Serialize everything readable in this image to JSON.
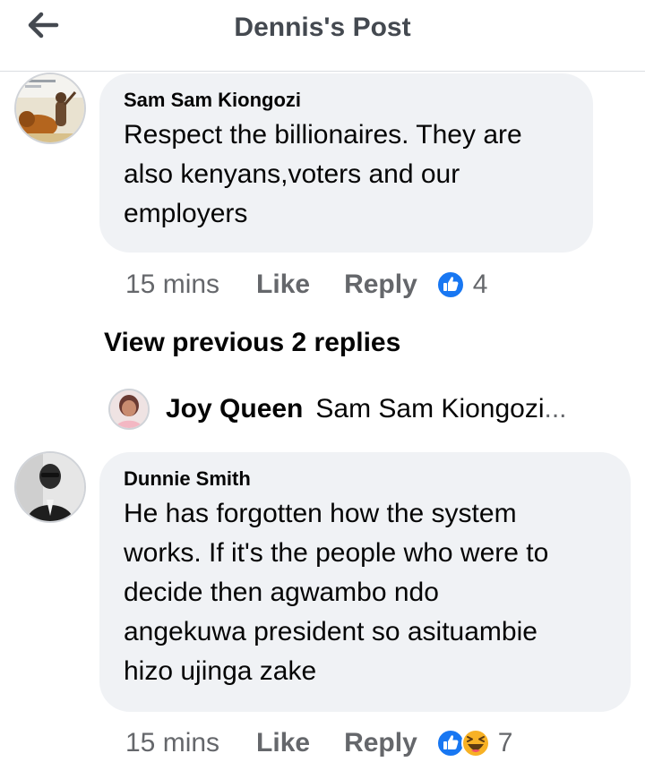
{
  "header": {
    "title": "Dennis's Post",
    "back_icon": "arrow-left-icon"
  },
  "comments": [
    {
      "author": "Sam Sam Kiongozi",
      "lines": [
        "Respect the billionaires. They are",
        "also kenyans,voters and our",
        "employers"
      ],
      "time": "15 mins",
      "like_label": "Like",
      "reply_label": "Reply",
      "reactions": [
        "like-reaction-icon"
      ],
      "reaction_count": "4"
    },
    {
      "author": "Dunnie Smith",
      "lines": [
        "He has forgotten how the system",
        "works. If it's the people who were to",
        "decide then agwambo ndo",
        "angekuwa president so asituambie",
        "hizo ujinga zake"
      ],
      "time": "15 mins",
      "like_label": "Like",
      "reply_label": "Reply",
      "reactions": [
        "like-reaction-icon",
        "haha-reaction-icon"
      ],
      "reaction_count": "7"
    }
  ],
  "replies": {
    "view_previous": "View previous 2 replies",
    "preview_author": "Joy Queen",
    "preview_text": "Sam Sam Kiongozi",
    "preview_ellipsis": "..."
  },
  "colors": {
    "bubble": "#f0f2f5",
    "secondary_text": "#65676b",
    "like_blue": "#1877f2",
    "haha_yellow": "#f7b125"
  }
}
